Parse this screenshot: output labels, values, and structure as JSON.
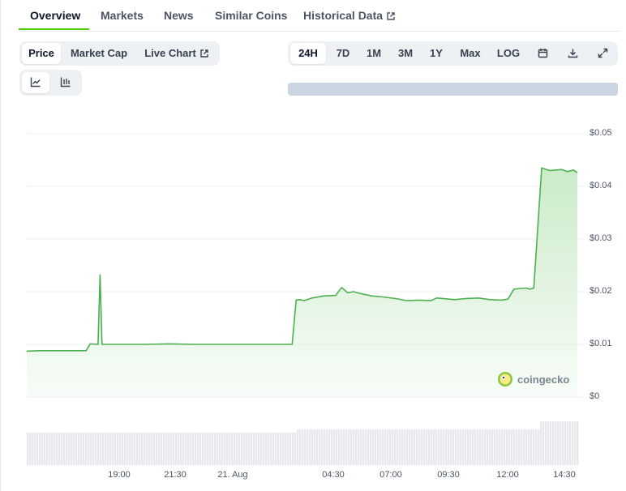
{
  "tabs": [
    {
      "label": "Overview"
    },
    {
      "label": "Markets"
    },
    {
      "label": "News"
    },
    {
      "label": "Similar Coins"
    },
    {
      "label": "Historical Data"
    }
  ],
  "view_toggle": {
    "price": "Price",
    "market_cap": "Market Cap",
    "live_chart": "Live Chart",
    "selected": "Price"
  },
  "chart_type_toggle": {
    "icons": [
      "line-chart-icon",
      "candlestick-icon"
    ],
    "selected": "line-chart-icon"
  },
  "range_toggle": {
    "options": [
      "24H",
      "7D",
      "1M",
      "3M",
      "1Y",
      "Max",
      "LOG"
    ],
    "selected": "24H",
    "icons": [
      "calendar-icon",
      "download-icon",
      "expand-icon"
    ]
  },
  "watermark": "coingecko",
  "colors": {
    "accent": "#4bcc00",
    "line": "#4caf50",
    "area_top": "#cdeccb",
    "volume": "#e5e7eb",
    "range_bar": "#cbd5e1"
  },
  "chart_data": {
    "type": "area",
    "title": "",
    "xlabel": "",
    "ylabel": "",
    "x_ticks": [
      "19:00",
      "21:30",
      "21. Aug",
      "04:30",
      "07:00",
      "09:30",
      "12:00",
      "14:30"
    ],
    "y_ticks": [
      "$0",
      "$0.01",
      "$0.02",
      "$0.03",
      "$0.04",
      "$0.05"
    ],
    "ylim": [
      0,
      0.05
    ],
    "grid": true,
    "series": [
      {
        "values_x": [
          "16:00",
          "16:30",
          "17:00",
          "17:30",
          "18:00",
          "18:30",
          "18:40",
          "19:00",
          "19:05",
          "19:10",
          "19:20",
          "20:00",
          "21:00",
          "22:00",
          "23:00",
          "00:00",
          "01:00",
          "02:00",
          "03:00",
          "03:10",
          "03:20",
          "03:30",
          "03:40",
          "04:00",
          "04:30",
          "05:00",
          "05:15",
          "05:30",
          "05:45",
          "06:00",
          "06:30",
          "07:00",
          "07:30",
          "08:00",
          "08:30",
          "09:00",
          "09:15",
          "09:30",
          "10:00",
          "10:30",
          "11:00",
          "11:30",
          "12:00",
          "12:15",
          "12:30",
          "13:00",
          "13:10",
          "13:20",
          "13:40",
          "14:00",
          "14:30",
          "14:45",
          "15:00",
          "15:10"
        ],
        "values_y": [
          0.0087,
          0.0088,
          0.0088,
          0.0088,
          0.0088,
          0.0088,
          0.0101,
          0.01,
          0.0232,
          0.01,
          0.01,
          0.01,
          0.01,
          0.0101,
          0.01,
          0.01,
          0.01,
          0.01,
          0.01,
          0.01,
          0.0184,
          0.0185,
          0.0183,
          0.0188,
          0.0192,
          0.0193,
          0.0208,
          0.0198,
          0.02,
          0.0197,
          0.0192,
          0.019,
          0.0187,
          0.0183,
          0.0184,
          0.0183,
          0.0188,
          0.0187,
          0.0185,
          0.0187,
          0.0188,
          0.0185,
          0.0184,
          0.0186,
          0.0205,
          0.0207,
          0.0205,
          0.0207,
          0.0435,
          0.043,
          0.0432,
          0.0428,
          0.0431,
          0.0426
        ]
      }
    ],
    "volume": "low, roughly constant bars across the day, rising after the final price jump"
  }
}
